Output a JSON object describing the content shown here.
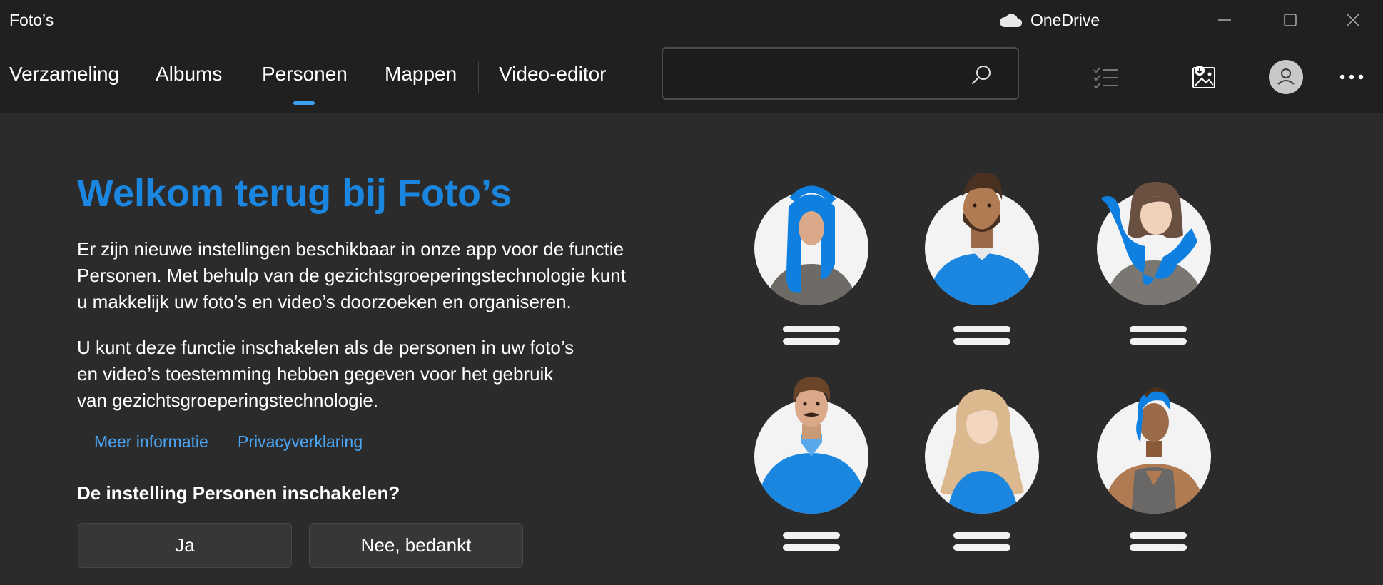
{
  "window": {
    "title": "Foto’s",
    "onedrive_label": "OneDrive"
  },
  "nav": {
    "tabs": [
      {
        "label": "Verzameling"
      },
      {
        "label": "Albums"
      },
      {
        "label": "Personen",
        "active": true
      },
      {
        "label": "Mappen"
      },
      {
        "label": "Video-editor"
      }
    ],
    "search": {
      "value": "",
      "placeholder": ""
    }
  },
  "main": {
    "heading": "Welkom terug bij Foto’s",
    "paragraph1": [
      "Er zijn nieuwe instellingen beschikbaar in onze app voor de functie",
      "Personen. Met behulp van de gezichtsgroeperingstechnologie kunt",
      "u makkelijk uw foto’s en video’s doorzoeken en organiseren."
    ],
    "paragraph2": [
      "U kunt deze functie inschakelen als de personen in uw foto’s",
      "en video’s toestemming hebben gegeven voor het gebruik",
      "van gezichtsgroeperingstechnologie."
    ],
    "links": {
      "more_info": "Meer informatie",
      "privacy": "Privacyverklaring"
    },
    "question": "De instelling Personen inschakelen?",
    "buttons": {
      "yes": "Ja",
      "no": "Nee, bedankt"
    }
  },
  "colors": {
    "accent": "#1a86e0",
    "link": "#4aa6f5",
    "titlebar_bg": "#202020",
    "content_bg": "#2b2b2b"
  },
  "icons": [
    "onedrive-cloud-icon",
    "minimize-icon",
    "maximize-icon",
    "close-icon",
    "search-icon",
    "select-checklist-icon",
    "import-icon",
    "account-icon",
    "more-icon"
  ]
}
